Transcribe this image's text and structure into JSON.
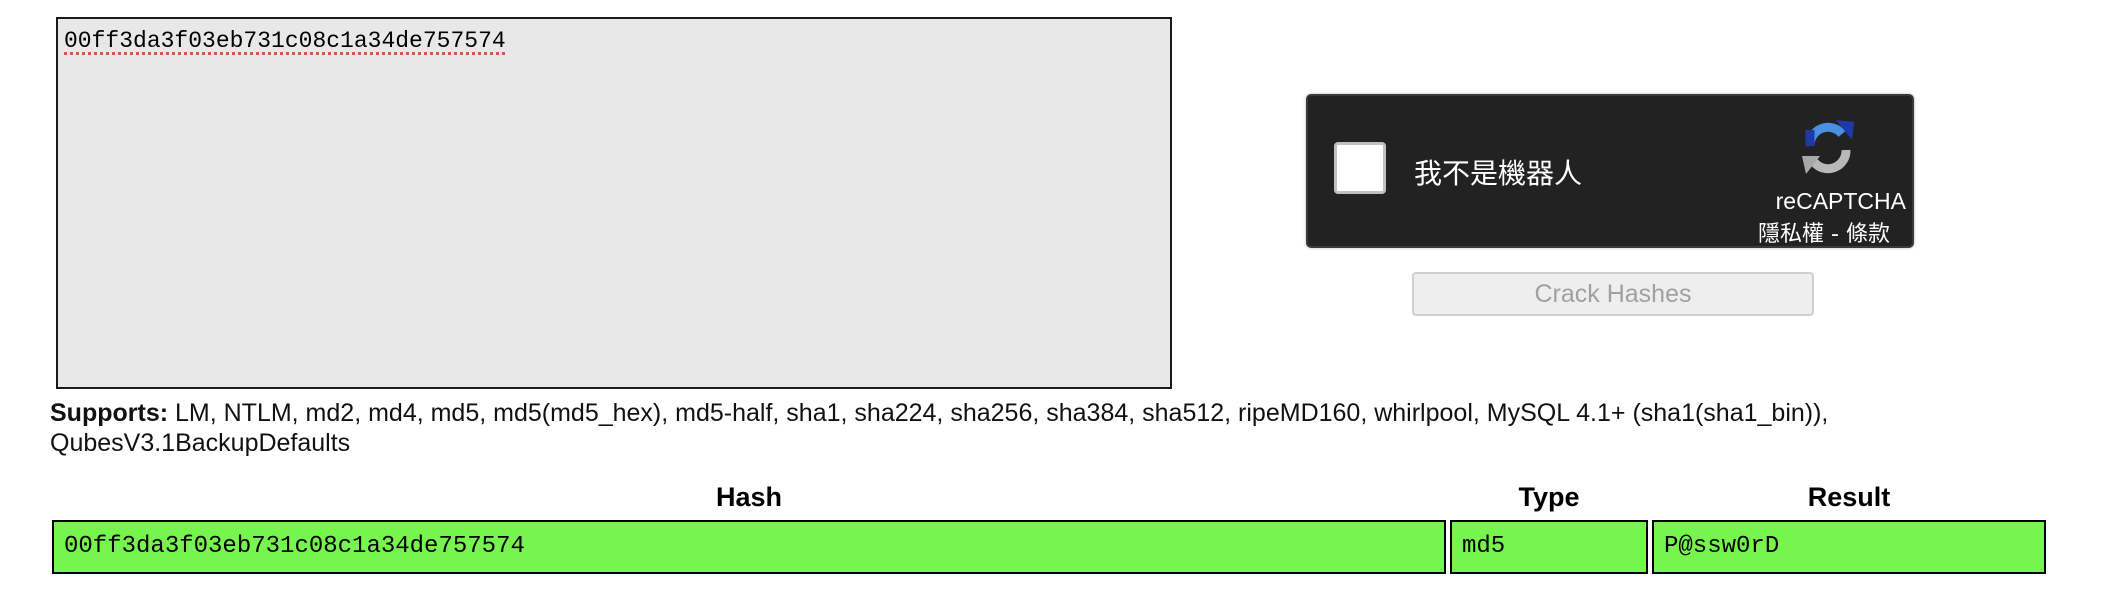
{
  "hash_input": {
    "value": "00ff3da3f03eb731c08c1a34de757574"
  },
  "recaptcha": {
    "checkbox_label": "我不是機器人",
    "brand": "reCAPTCHA",
    "privacy_label": "隱私權",
    "separator": " - ",
    "terms_label": "條款",
    "icon": "recaptcha-logo-icon"
  },
  "crack_button": {
    "label": "Crack Hashes"
  },
  "supports": {
    "label": "Supports:",
    "text": " LM, NTLM, md2, md4, md5, md5(md5_hex), md5-half, sha1, sha224, sha256, sha384, sha512, ripeMD160, whirlpool, MySQL 4.1+ (sha1(sha1_bin)), QubesV3.1BackupDefaults"
  },
  "results": {
    "headers": {
      "hash": "Hash",
      "type": "Type",
      "result": "Result"
    },
    "rows": [
      {
        "hash": "00ff3da3f03eb731c08c1a34de757574",
        "type": "md5",
        "result": "P@ssw0rD"
      }
    ]
  },
  "colors": {
    "found_row": "#77f54f",
    "captcha_bg": "#222222",
    "textarea_bg": "#e8e8e8"
  }
}
